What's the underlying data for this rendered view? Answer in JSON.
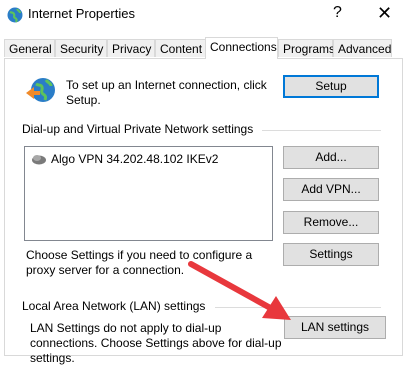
{
  "window": {
    "title": "Internet Properties",
    "help_glyph": "?",
    "close_glyph": "✕"
  },
  "tabs": [
    {
      "label": "General"
    },
    {
      "label": "Security"
    },
    {
      "label": "Privacy"
    },
    {
      "label": "Content"
    },
    {
      "label": "Connections",
      "active": true
    },
    {
      "label": "Programs"
    },
    {
      "label": "Advanced"
    }
  ],
  "setup": {
    "description": "To set up an Internet connection, click Setup.",
    "button": "Setup"
  },
  "dialup": {
    "section_label": "Dial-up and Virtual Private Network settings",
    "connections": [
      {
        "label": "Algo VPN 34.202.48.102 IKEv2"
      }
    ],
    "add_button": "Add...",
    "add_vpn_button": "Add VPN...",
    "remove_button": "Remove...",
    "proxy_text": "Choose Settings if you need to configure a proxy server for a connection.",
    "settings_button": "Settings"
  },
  "lan": {
    "section_label": "Local Area Network (LAN) settings",
    "note": "LAN Settings do not apply to dial-up connections. Choose Settings above for dial-up settings.",
    "button": "LAN settings"
  },
  "colors": {
    "focus": "#0078d7",
    "annotation_arrow": "#e8383d"
  }
}
